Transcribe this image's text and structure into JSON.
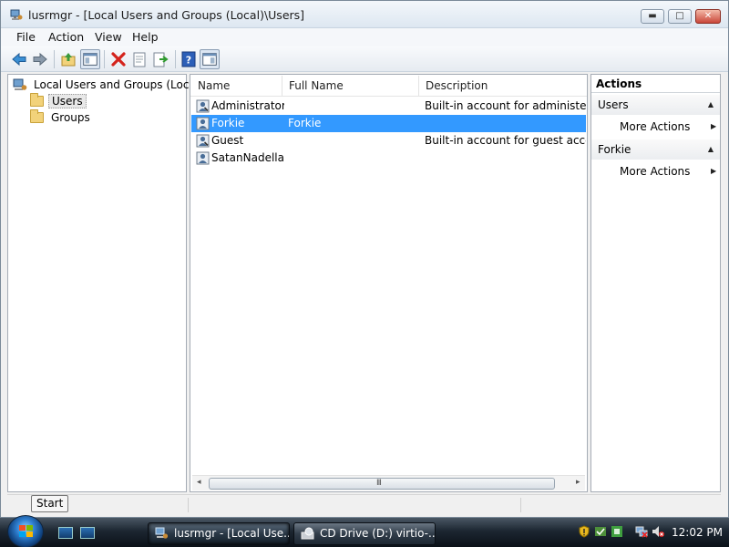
{
  "window": {
    "title": "lusrmgr - [Local Users and Groups (Local)\\Users]",
    "buttons": {
      "minimize": "▬",
      "maximize": "□",
      "close": "✕"
    }
  },
  "menu": [
    "File",
    "Action",
    "View",
    "Help"
  ],
  "toolbar": {
    "icons": [
      "back-arrow-icon",
      "forward-arrow-icon",
      "up-folder-icon",
      "show-hide-console-tree-icon",
      "delete-icon",
      "properties-icon",
      "export-list-icon",
      "help-icon",
      "show-hide-action-pane-icon"
    ]
  },
  "tree": {
    "root": "Local Users and Groups (Local)",
    "children": [
      {
        "label": "Users",
        "selected": true
      },
      {
        "label": "Groups",
        "selected": false
      }
    ]
  },
  "list": {
    "columns": [
      "Name",
      "Full Name",
      "Description"
    ],
    "rows": [
      {
        "name": "Administrator",
        "full_name": "",
        "description": "Built-in account for administering",
        "selected": false
      },
      {
        "name": "Forkie",
        "full_name": "Forkie",
        "description": "",
        "selected": true
      },
      {
        "name": "Guest",
        "full_name": "",
        "description": "Built-in account for guest access t",
        "selected": false
      },
      {
        "name": "SatanNadella",
        "full_name": "",
        "description": "",
        "selected": false
      }
    ],
    "scroll_left": "◂",
    "scroll_right": "▸",
    "scroll_grip": "III"
  },
  "actions": {
    "title": "Actions",
    "sections": [
      {
        "label": "Users",
        "item": "More Actions"
      },
      {
        "label": "Forkie",
        "item": "More Actions"
      }
    ],
    "collapse_glyph": "▲",
    "expand_glyph": "▶"
  },
  "statusbar": {
    "tooltip": "Start"
  },
  "taskbar": {
    "buttons": [
      {
        "label": "lusrmgr - [Local Use...",
        "active": true
      },
      {
        "label": "CD Drive (D:) virtio-...",
        "active": false
      }
    ],
    "clock": "12:02 PM"
  },
  "colors": {
    "selection": "#3399ff",
    "taskbar": "#1c2631"
  }
}
